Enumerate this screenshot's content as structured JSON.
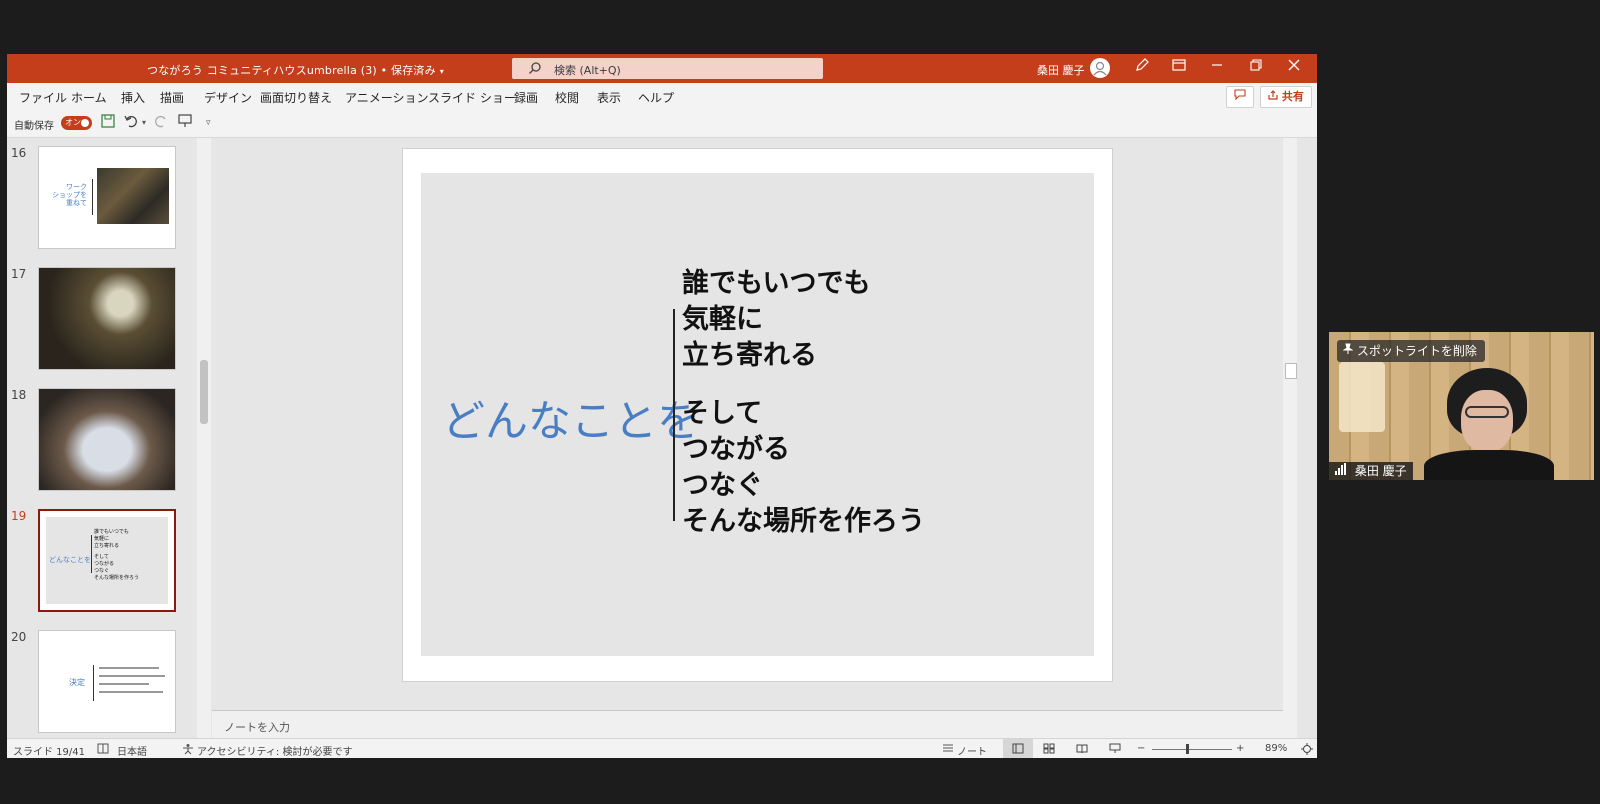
{
  "window": {
    "doc_title": "つながろう コミュニティハウスumbrella (3) • 保存済み",
    "title_caret": "▾",
    "search_placeholder": "検索 (Alt+Q)",
    "user_name": "桑田 慶子",
    "colors": {
      "accent": "#c43e1c",
      "slide_heading": "#4a7ec4"
    }
  },
  "menu": {
    "items": [
      "ファイル",
      "ホーム",
      "挿入",
      "描画",
      "デザイン",
      "画面切り替え",
      "アニメーション",
      "スライド ショー",
      "録画",
      "校閲",
      "表示",
      "ヘルプ"
    ],
    "share_label": "共有"
  },
  "qat": {
    "autosave_label": "自動保存",
    "autosave_state": "オン"
  },
  "thumbnails": [
    {
      "num": "16",
      "text": "ワーク\nショップを\n重ねて"
    },
    {
      "num": "17"
    },
    {
      "num": "18"
    },
    {
      "num": "19",
      "heading": "どんなことを",
      "lines": [
        "誰でもいつでも",
        "気軽に",
        "立ち寄れる",
        "そして",
        "つながる",
        "つなぐ",
        "そんな場所を作ろう"
      ]
    },
    {
      "num": "20",
      "heading": "決定"
    }
  ],
  "slide": {
    "heading": "どんなことを",
    "lines": [
      "誰でもいつでも",
      "気軽に",
      "立ち寄れる",
      "そして",
      "つながる",
      "つなぐ",
      "そんな場所を作ろう"
    ]
  },
  "notes_placeholder": "ノートを入力",
  "status": {
    "slide_indicator": "スライド 19/41",
    "language": "日本語",
    "accessibility": "アクセシビリティ: 検討が必要です",
    "notes_label": "ノート",
    "zoom": "89%"
  },
  "video": {
    "spotlight_label": "スポットライトを削除",
    "participant_name": "桑田 慶子"
  }
}
